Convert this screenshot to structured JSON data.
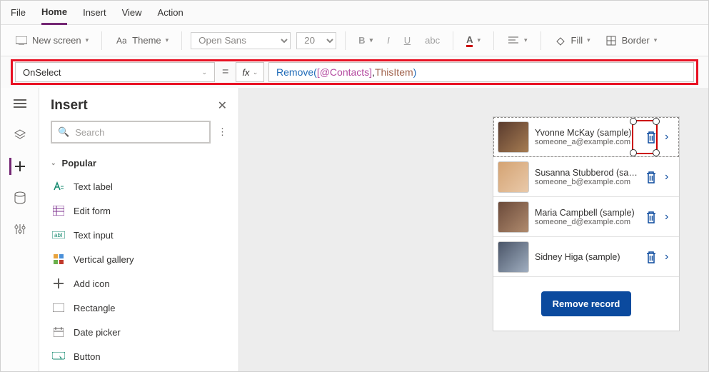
{
  "menubar": {
    "tabs": [
      "File",
      "Home",
      "Insert",
      "View",
      "Action"
    ],
    "active": "Home"
  },
  "ribbon": {
    "new_screen": "New screen",
    "theme": "Theme",
    "font_family": "Open Sans",
    "font_size": "20",
    "fill": "Fill",
    "border": "Border"
  },
  "formula": {
    "property": "OnSelect",
    "fx_label": "fx",
    "fn": "Remove",
    "datasource": "[@Contacts]",
    "arg": "ThisItem",
    "raw": "Remove( [@Contacts], ThisItem )"
  },
  "insert_panel": {
    "title": "Insert",
    "search_placeholder": "Search",
    "group_label": "Popular",
    "items": [
      {
        "icon": "text-label",
        "label": "Text label"
      },
      {
        "icon": "edit-form",
        "label": "Edit form"
      },
      {
        "icon": "text-input",
        "label": "Text input"
      },
      {
        "icon": "vertical-gallery",
        "label": "Vertical gallery"
      },
      {
        "icon": "add-icon",
        "label": "Add icon"
      },
      {
        "icon": "rectangle",
        "label": "Rectangle"
      },
      {
        "icon": "date-picker",
        "label": "Date picker"
      },
      {
        "icon": "button",
        "label": "Button"
      }
    ]
  },
  "contacts": [
    {
      "name": "Yvonne McKay (sample)",
      "email": "someone_a@example.com",
      "selected_trash": true
    },
    {
      "name": "Susanna Stubberod (sample)",
      "email": "someone_b@example.com"
    },
    {
      "name": "Maria Campbell (sample)",
      "email": "someone_d@example.com"
    },
    {
      "name": "Sidney Higa (sample)",
      "email": ""
    }
  ],
  "remove_btn": "Remove record"
}
